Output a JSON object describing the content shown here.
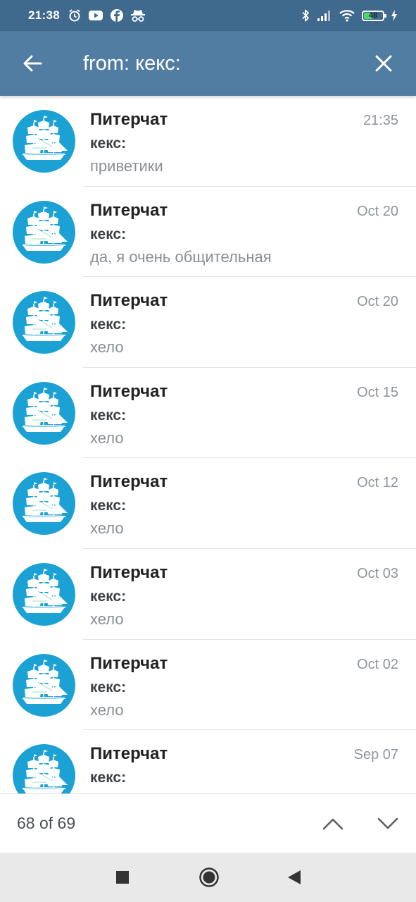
{
  "status_bar": {
    "time": "21:38",
    "battery_level": "48",
    "battery_color": "#4cd964",
    "left_icons": [
      "alarm-icon",
      "youtube-icon",
      "facebook-icon",
      "incognito-icon"
    ],
    "right_icons": [
      "bluetooth-icon",
      "signal-icon",
      "wifi-icon",
      "battery-icon",
      "charging-icon"
    ]
  },
  "toolbar": {
    "search_query": "from: кекс:",
    "back_icon": "arrow-left-icon",
    "clear_icon": "close-icon",
    "background_color": "#527da3"
  },
  "results": [
    {
      "chat": "Питерчат",
      "date": "21:35",
      "sender": "кекс:",
      "message": "приветики"
    },
    {
      "chat": "Питерчат",
      "date": "Oct 20",
      "sender": "кекс:",
      "message": "да, я очень общительная"
    },
    {
      "chat": "Питерчат",
      "date": "Oct 20",
      "sender": "кекс:",
      "message": "хело"
    },
    {
      "chat": "Питерчат",
      "date": "Oct 15",
      "sender": "кекс:",
      "message": "хело"
    },
    {
      "chat": "Питерчат",
      "date": "Oct 12",
      "sender": "кекс:",
      "message": "хело"
    },
    {
      "chat": "Питерчат",
      "date": "Oct 03",
      "sender": "кекс:",
      "message": "хело"
    },
    {
      "chat": "Питерчат",
      "date": "Oct 02",
      "sender": "кекс:",
      "message": "хело"
    },
    {
      "chat": "Питерчат",
      "date": "Sep 07",
      "sender": "кекс:",
      "message": ""
    }
  ],
  "avatar": {
    "icon": "sailing-ship-icon",
    "background_color": "#1ba1d4"
  },
  "results_bar": {
    "count_text": "68 of 69",
    "up_icon": "chevron-up-icon",
    "down_icon": "chevron-down-icon"
  },
  "system_nav": {
    "buttons": [
      "recents-square-icon",
      "home-circle-icon",
      "back-triangle-icon"
    ]
  }
}
